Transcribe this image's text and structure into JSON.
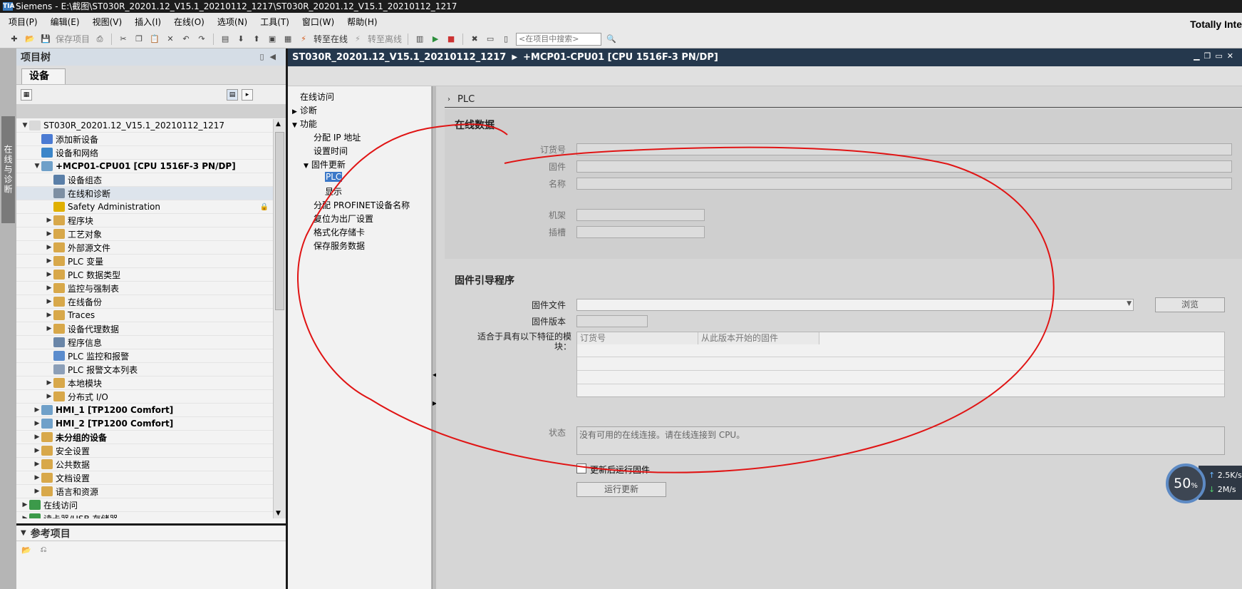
{
  "titlebar": {
    "app": "Siemens",
    "path": "E:\\截图\\ST030R_20201.12_V15.1_20210112_1217\\ST030R_20201.12_V15.1_20210112_1217"
  },
  "menu": [
    "项目(P)",
    "编辑(E)",
    "视图(V)",
    "插入(I)",
    "在线(O)",
    "选项(N)",
    "工具(T)",
    "窗口(W)",
    "帮助(H)"
  ],
  "brand": "Totally Inte",
  "toolbar": {
    "save_label": "保存项目",
    "go_online": "转至在线",
    "go_offline": "转至离线",
    "search_placeholder": "<在项目中搜索>"
  },
  "vtab": {
    "label": "在线与诊断"
  },
  "tree": {
    "header": "项目树",
    "tab": "设备",
    "items": [
      {
        "label": "ST030R_20201.12_V15.1_20210112_1217",
        "level": 0,
        "expand": "▼",
        "icon": "project-icon",
        "color": "#d9d9d9",
        "bold": false,
        "selected": false
      },
      {
        "label": "添加新设备",
        "level": 1,
        "expand": "",
        "icon": "add-device-icon",
        "color": "#4b7bd3",
        "bold": false,
        "selected": false
      },
      {
        "label": "设备和网络",
        "level": 1,
        "expand": "",
        "icon": "network-icon",
        "color": "#3c86c9",
        "bold": false,
        "selected": false
      },
      {
        "label": "+MCP01-CPU01 [CPU 1516F-3 PN/DP]",
        "level": 1,
        "expand": "▼",
        "icon": "cpu-icon",
        "color": "#6fa0c9",
        "bold": true,
        "selected": false
      },
      {
        "label": "设备组态",
        "level": 2,
        "expand": "",
        "icon": "device-config-icon",
        "color": "#5a7fa8",
        "bold": false,
        "selected": false
      },
      {
        "label": "在线和诊断",
        "level": 2,
        "expand": "",
        "icon": "diagnostics-icon",
        "color": "#7d8fa3",
        "bold": false,
        "selected": true
      },
      {
        "label": "Safety Administration",
        "level": 2,
        "expand": "",
        "icon": "safety-icon",
        "color": "#e0b000",
        "bold": false,
        "selected": false
      },
      {
        "label": "程序块",
        "level": 2,
        "expand": "▶",
        "icon": "folder-icon",
        "color": "#d8a84a",
        "bold": false,
        "selected": false
      },
      {
        "label": "工艺对象",
        "level": 2,
        "expand": "▶",
        "icon": "folder-icon",
        "color": "#d8a84a",
        "bold": false,
        "selected": false
      },
      {
        "label": "外部源文件",
        "level": 2,
        "expand": "▶",
        "icon": "folder-icon",
        "color": "#d8a84a",
        "bold": false,
        "selected": false
      },
      {
        "label": "PLC 变量",
        "level": 2,
        "expand": "▶",
        "icon": "folder-icon",
        "color": "#d8a84a",
        "bold": false,
        "selected": false
      },
      {
        "label": "PLC 数据类型",
        "level": 2,
        "expand": "▶",
        "icon": "folder-icon",
        "color": "#d8a84a",
        "bold": false,
        "selected": false
      },
      {
        "label": "监控与强制表",
        "level": 2,
        "expand": "▶",
        "icon": "folder-icon",
        "color": "#d8a84a",
        "bold": false,
        "selected": false
      },
      {
        "label": "在线备份",
        "level": 2,
        "expand": "▶",
        "icon": "folder-icon",
        "color": "#d8a84a",
        "bold": false,
        "selected": false
      },
      {
        "label": "Traces",
        "level": 2,
        "expand": "▶",
        "icon": "folder-icon",
        "color": "#d8a84a",
        "bold": false,
        "selected": false
      },
      {
        "label": "设备代理数据",
        "level": 2,
        "expand": "▶",
        "icon": "folder-icon",
        "color": "#d8a84a",
        "bold": false,
        "selected": false
      },
      {
        "label": "程序信息",
        "level": 2,
        "expand": "",
        "icon": "program-info-icon",
        "color": "#6a86a8",
        "bold": false,
        "selected": false
      },
      {
        "label": "PLC 监控和报警",
        "level": 2,
        "expand": "",
        "icon": "alarm-icon",
        "color": "#5b8ccd",
        "bold": false,
        "selected": false
      },
      {
        "label": "PLC 报警文本列表",
        "level": 2,
        "expand": "",
        "icon": "text-list-icon",
        "color": "#8c9fb8",
        "bold": false,
        "selected": false
      },
      {
        "label": "本地模块",
        "level": 2,
        "expand": "▶",
        "icon": "folder-icon",
        "color": "#d8a84a",
        "bold": false,
        "selected": false
      },
      {
        "label": "分布式 I/O",
        "level": 2,
        "expand": "▶",
        "icon": "folder-icon",
        "color": "#d8a84a",
        "bold": false,
        "selected": false
      },
      {
        "label": "HMI_1 [TP1200 Comfort]",
        "level": 1,
        "expand": "▶",
        "icon": "hmi-icon",
        "color": "#6fa0c9",
        "bold": true,
        "selected": false
      },
      {
        "label": "HMI_2 [TP1200 Comfort]",
        "level": 1,
        "expand": "▶",
        "icon": "hmi-icon",
        "color": "#6fa0c9",
        "bold": true,
        "selected": false
      },
      {
        "label": "未分组的设备",
        "level": 1,
        "expand": "▶",
        "icon": "folder-icon",
        "color": "#d8a84a",
        "bold": true,
        "selected": false
      },
      {
        "label": "安全设置",
        "level": 1,
        "expand": "▶",
        "icon": "security-icon",
        "color": "#d8a84a",
        "bold": false,
        "selected": false
      },
      {
        "label": "公共数据",
        "level": 1,
        "expand": "▶",
        "icon": "common-data-icon",
        "color": "#d8a84a",
        "bold": false,
        "selected": false
      },
      {
        "label": "文档设置",
        "level": 1,
        "expand": "▶",
        "icon": "doc-settings-icon",
        "color": "#d8a84a",
        "bold": false,
        "selected": false
      },
      {
        "label": "语言和资源",
        "level": 1,
        "expand": "▶",
        "icon": "language-icon",
        "color": "#d8a84a",
        "bold": false,
        "selected": false
      },
      {
        "label": "在线访问",
        "level": 0,
        "expand": "▶",
        "icon": "online-access-icon",
        "color": "#3c9a4a",
        "bold": false,
        "selected": false
      },
      {
        "label": "读卡器/USB 存储器",
        "level": 0,
        "expand": "▶",
        "icon": "card-reader-icon",
        "color": "#3c9a4a",
        "bold": false,
        "selected": false
      }
    ]
  },
  "ref": {
    "header": "参考项目"
  },
  "editor": {
    "breadcrumb_project": "ST030R_20201.12_V15.1_20210112_1217",
    "breadcrumb_device": "+MCP01-CPU01 [CPU 1516F-3 PN/DP]"
  },
  "nav": {
    "online_access": "在线访问",
    "diagnostics": "诊断",
    "functions": "功能",
    "assign_ip": "分配 IP 地址",
    "set_time": "设置时间",
    "fw_update": "固件更新",
    "plc": "PLC",
    "display": "显示",
    "assign_profinet": "分配 PROFINET设备名称",
    "factory_reset": "复位为出厂设置",
    "format_card": "格式化存储卡",
    "save_service": "保存服务数据"
  },
  "content": {
    "plc_title": "PLC",
    "online_data": {
      "title": "在线数据",
      "order_no": "订货号",
      "firmware": "固件",
      "name": "名称",
      "rack": "机架",
      "slot": "插槽"
    },
    "fw_loader": {
      "title": "固件引导程序",
      "fw_file": "固件文件",
      "browse": "浏览",
      "fw_version": "固件版本",
      "suitable": "适合于具有以下特征的模块：",
      "col_order": "订货号",
      "col_from_version": "从此版本开始的固件"
    },
    "status_label": "状态",
    "status_text": "没有可用的在线连接。请在线连接到 CPU。",
    "run_after_update": "更新后运行固件",
    "run_update": "运行更新"
  },
  "speed": {
    "percent": "50",
    "unit": "%",
    "up": "2.5K/s",
    "down": "2M/s"
  }
}
